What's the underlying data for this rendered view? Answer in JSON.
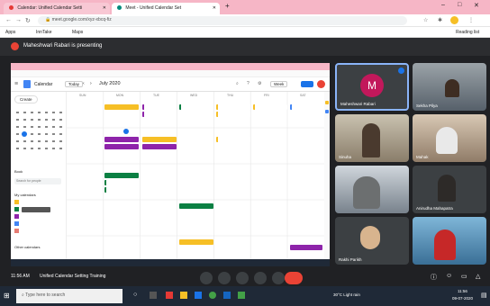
{
  "browser": {
    "tabs": [
      {
        "title": "Calendar: Unified Calendar Setti"
      },
      {
        "title": "Meet - Unified Calendar Set"
      }
    ],
    "address": "meet.google.com/xyz-xbcq-fiz",
    "bookmarks": [
      "Apps",
      "InnTake",
      "Maps",
      "Reading list"
    ]
  },
  "meet": {
    "presenting_text": "Maheshwari Rabari is presenting",
    "meeting_time": "11:56 AM",
    "meeting_title": "Unified Calendar Setting Training",
    "participants": [
      {
        "name": "Maheshwari Rabari",
        "initial": "M"
      },
      {
        "name": "Sekha Pilya"
      },
      {
        "name": "Sinuha"
      },
      {
        "name": "Mahak"
      },
      {
        "name": ""
      },
      {
        "name": "Anirudha Mahapatra"
      },
      {
        "name": "Rakhi Parikh"
      },
      {
        "name": ""
      }
    ]
  },
  "calendar": {
    "app_title": "Calendar",
    "today_label": "Today",
    "month_label": "July 2020",
    "view_label": "Week",
    "create_label": "Create",
    "my_calendars_label": "My calendars",
    "other_calendars_label": "Other calendars",
    "search_people_placeholder": "Search for people",
    "book_label": "Book",
    "weekdays": [
      "SUN",
      "MON",
      "TUE",
      "WED",
      "THU",
      "FRI",
      "SAT"
    ]
  },
  "taskbar": {
    "search_placeholder": "Type here to search",
    "time": "11:56",
    "date": "09-07-2020",
    "weather": "30°C Light rain"
  },
  "colors": {
    "accent_red": "#ea4335",
    "event_yellow": "#f6bf26",
    "event_purple": "#8e24aa",
    "event_green": "#0b8043"
  }
}
